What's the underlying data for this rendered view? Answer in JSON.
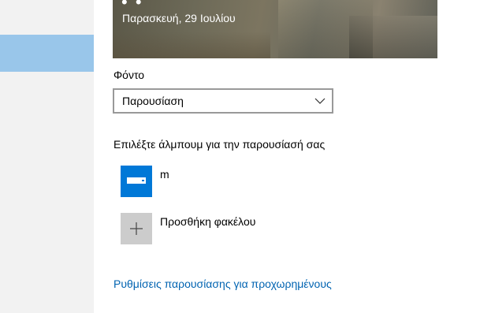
{
  "preview": {
    "time_partial": "• •",
    "date": "Παρασκευή, 29 Ιουλίου"
  },
  "background": {
    "label": "Φόντο",
    "dropdown_value": "Παρουσίαση",
    "dropdown_icon": "chevron-down-icon"
  },
  "albums": {
    "label": "Επιλέξτε άλμπουμ για την παρουσίασή σας",
    "items": [
      {
        "label": "m",
        "icon": "drive-icon",
        "tile_color": "#0078d7"
      }
    ],
    "add_folder_label": "Προσθήκη φακέλου",
    "add_icon": "plus-icon"
  },
  "advanced_link": "Ρυθμίσεις παρουσίασης για προχωρημένους",
  "colors": {
    "accent": "#0078d7",
    "link": "#0063b1",
    "sidebar_selected": "#99c6ea",
    "sidebar": "#f2f2f2"
  }
}
